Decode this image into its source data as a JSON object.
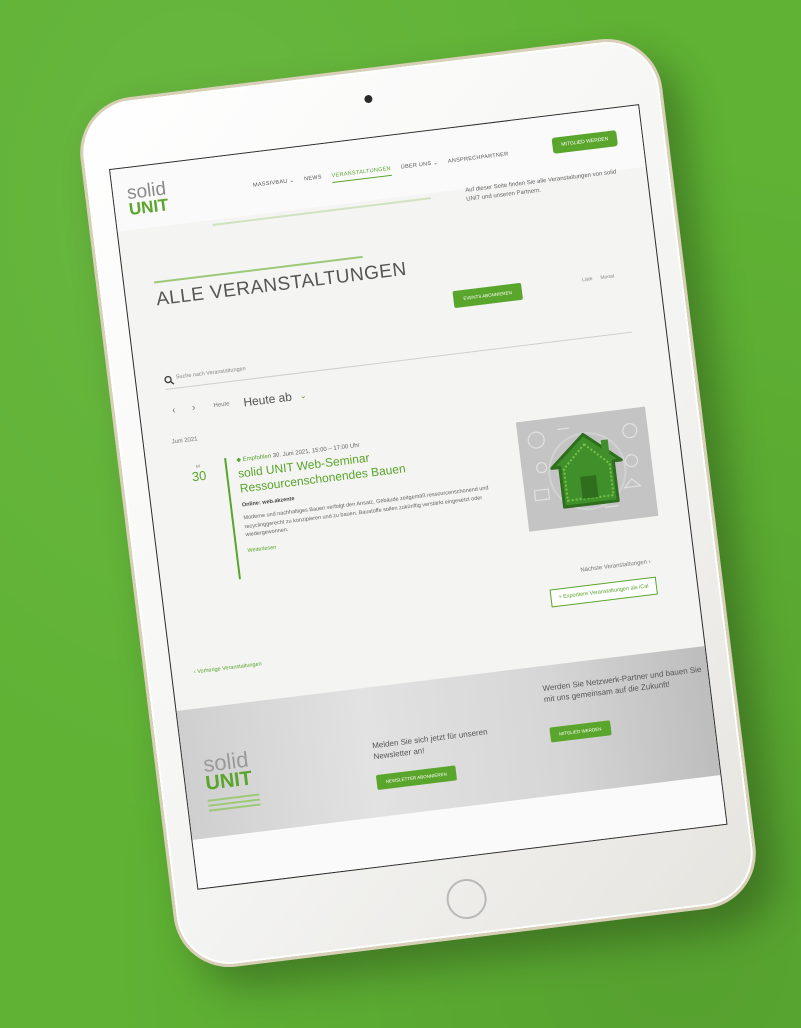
{
  "header": {
    "logo_solid": "solid",
    "logo_unit": "UNIT",
    "nav": [
      {
        "label": "MASSIVBAU ⌄",
        "active": false
      },
      {
        "label": "NEWS",
        "active": false
      },
      {
        "label": "VERANSTALTUNGEN",
        "active": true
      },
      {
        "label": "ÜBER UNS ⌄",
        "active": false
      },
      {
        "label": "ANSPRECHPARTNER",
        "active": false
      }
    ],
    "cta": "MITGLIED WERDEN"
  },
  "intro_text": "Auf dieser Seite finden Sie alle Veranstaltungen von solid UNIT und unseren Partnern.",
  "page_title": "ALLE VERANSTALTUNGEN",
  "subscribe_button": "EVENTS ABONNIEREN",
  "view_links": [
    "Liste",
    "Monat"
  ],
  "search": {
    "placeholder": "Suche nach Veranstaltungen"
  },
  "date_nav": {
    "today": "Heute",
    "label": "Heute ab",
    "chevron": "⌄",
    "month": "Juni 2021"
  },
  "event": {
    "weekday": "MI",
    "day": "30",
    "tag": "Empfohlen",
    "datetime": "30. Juni 2021, 15:00 – 17:00 Uhr",
    "title": "solid UNIT Web-Seminar Ressourcenschonendes Bauen",
    "location_label": "Online:",
    "location": "web.akzente",
    "description": "Moderne und nachhaltiges Bauen verfolgt den Ansatz, Gebäude zeitgemäß ressourcenschonend und recyclinggerecht zu konzipieren und zu bauen. Baustoffe sollen zukünftig verstärkt eingesetzt oder wiedergewonnen.",
    "more": "Weiterlesen"
  },
  "pagination": {
    "next": "Nächste Veranstaltungen ›",
    "export": "+ Exportiere Veranstaltungen als iCal",
    "prev": "‹ Vorherige Veranstaltungen"
  },
  "footer": {
    "logo_solid": "solid",
    "logo_unit": "UNIT",
    "newsletter_text": "Melden Sie sich jetzt für unseren Newsletter an!",
    "newsletter_button": "NEWSLETTER ABONNIEREN",
    "partner_text": "Werden Sie Netzwerk-Partner und bauen Sie mit uns gemeinsam auf die Zukunft!",
    "partner_button": "MITGLIED WERDEN"
  },
  "colors": {
    "background": "#5fb234",
    "accent": "#5aa52b",
    "tablet_frame": "#f3f3f1"
  },
  "icons": [
    "search-icon",
    "chevron-left-icon",
    "chevron-right-icon",
    "green-house-icon",
    "camera-icon",
    "home-button-icon"
  ]
}
